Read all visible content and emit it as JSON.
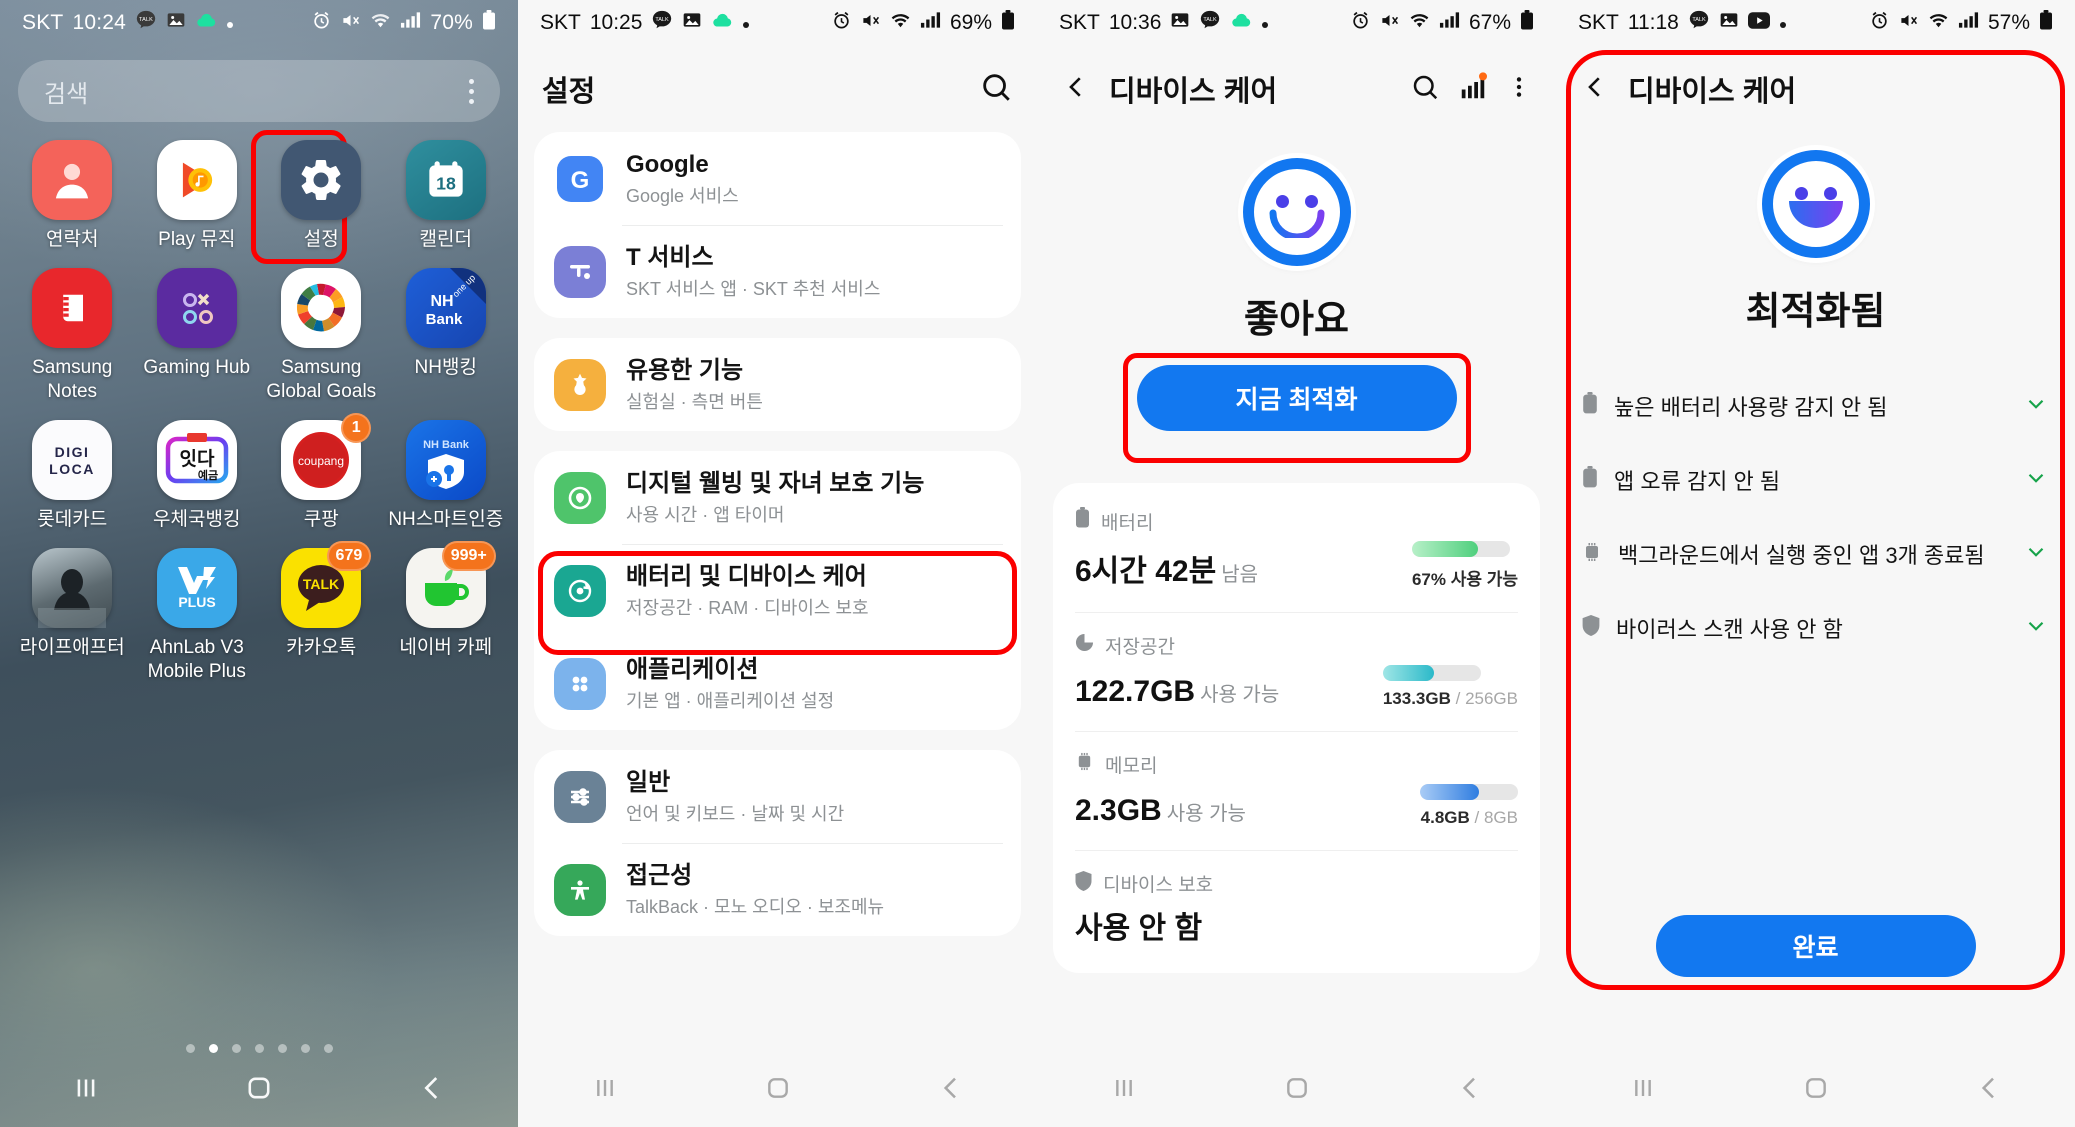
{
  "panel1": {
    "status": {
      "carrier": "SKT",
      "time": "10:24",
      "battery": "70%"
    },
    "search": {
      "placeholder": "검색"
    },
    "apps": [
      {
        "label": "연락처",
        "icon": "contacts-icon",
        "badge": null
      },
      {
        "label": "Play 뮤직",
        "icon": "play-music-icon",
        "badge": null
      },
      {
        "label": "설정",
        "icon": "settings-gear-icon",
        "badge": null,
        "highlighted": true
      },
      {
        "label": "캘린더",
        "icon": "calendar-icon",
        "badge": null,
        "day": "18"
      },
      {
        "label": "Samsung Notes",
        "icon": "samsung-notes-icon",
        "badge": null
      },
      {
        "label": "Gaming Hub",
        "icon": "gaming-hub-icon",
        "badge": null
      },
      {
        "label": "Samsung Global Goals",
        "icon": "global-goals-icon",
        "badge": null
      },
      {
        "label": "NH뱅킹",
        "icon": "nh-bank-icon",
        "badge": null,
        "mark": "one up"
      },
      {
        "label": "롯데카드",
        "icon": "digiloca-icon",
        "badge": null,
        "text1": "DIGI",
        "text2": "LOCA"
      },
      {
        "label": "우체국뱅킹",
        "icon": "itda-deposit-icon",
        "badge": null
      },
      {
        "label": "쿠팡",
        "icon": "coupang-icon",
        "badge": "1"
      },
      {
        "label": "NH스마트인증",
        "icon": "nh-smart-cert-icon",
        "badge": null
      },
      {
        "label": "라이프애프터",
        "icon": "lifeafter-icon",
        "badge": null
      },
      {
        "label": "AhnLab V3 Mobile Plus",
        "icon": "ahnlab-v3-icon",
        "badge": null
      },
      {
        "label": "카카오톡",
        "icon": "kakaotalk-icon",
        "badge": "679"
      },
      {
        "label": "네이버 카페",
        "icon": "naver-cafe-icon",
        "badge": "999+"
      }
    ],
    "page_dots": 7,
    "active_dot": 1
  },
  "panel2": {
    "status": {
      "carrier": "SKT",
      "time": "10:25",
      "battery": "69%"
    },
    "title": "설정",
    "search_icon": "search-icon",
    "groups": [
      {
        "items": [
          {
            "title": "Google",
            "sub": "Google 서비스",
            "icon": "google-icon",
            "color": "#4285f4"
          },
          {
            "title": "T 서비스",
            "sub": "SKT 서비스 앱 · SKT 추천 서비스",
            "icon": "t-service-icon",
            "color": "#7b7fd6"
          }
        ]
      },
      {
        "items": [
          {
            "title": "유용한 기능",
            "sub": "실험실 · 측면 버튼",
            "icon": "advanced-features-icon",
            "color": "#f5b03e"
          }
        ]
      },
      {
        "items": [
          {
            "title": "디지털 웰빙 및 자녀 보호 기능",
            "sub": "사용 시간 · 앱 타이머",
            "icon": "digital-wellbeing-icon",
            "color": "#4fc46b"
          },
          {
            "title": "배터리 및 디바이스 케어",
            "sub": "저장공간 · RAM · 디바이스 보호",
            "icon": "device-care-icon",
            "color": "#1aa792",
            "highlighted": true
          },
          {
            "title": "애플리케이션",
            "sub": "기본 앱 · 애플리케이션 설정",
            "icon": "applications-icon",
            "color": "#7cb3ec"
          }
        ]
      },
      {
        "items": [
          {
            "title": "일반",
            "sub": "언어 및 키보드 · 날짜 및 시간",
            "icon": "general-management-icon",
            "color": "#6a8296"
          },
          {
            "title": "접근성",
            "sub": "TalkBack · 모노 오디오 · 보조메뉴",
            "icon": "accessibility-icon",
            "color": "#36a85a"
          }
        ]
      }
    ]
  },
  "panel3": {
    "status": {
      "carrier": "SKT",
      "time": "10:36",
      "battery": "67%"
    },
    "title": "디바이스 케어",
    "actions": [
      "search-icon",
      "signal-bars-icon",
      "overflow-menu-icon"
    ],
    "face_icon": "smiley-face-icon",
    "status_text": "좋아요",
    "optimize_button": "지금 최적화",
    "metrics": [
      {
        "icon": "battery-icon",
        "label": "배터리",
        "value": "6시간 42분",
        "value_suffix": "남음",
        "caption": "67% 사용 가능",
        "caption_dim": "",
        "bar_percent": 67,
        "bar_color": "#5fd68a"
      },
      {
        "icon": "storage-icon",
        "label": "저장공간",
        "value": "122.7GB",
        "value_suffix": "사용 가능",
        "caption": "133.3GB",
        "caption_dim": "/ 256GB",
        "bar_percent": 52,
        "bar_color": "#3dc4ce"
      },
      {
        "icon": "memory-icon",
        "label": "메모리",
        "value": "2.3GB",
        "value_suffix": "사용 가능",
        "caption": "4.8GB",
        "caption_dim": "/ 8GB",
        "bar_percent": 60,
        "bar_color": "#3b82f6"
      },
      {
        "icon": "shield-icon",
        "label": "디바이스 보호",
        "value": "사용 안 함",
        "value_suffix": "",
        "caption": "",
        "caption_dim": "",
        "bar_percent": 0,
        "bar_color": ""
      }
    ]
  },
  "panel4": {
    "status": {
      "carrier": "SKT",
      "time": "11:18",
      "battery": "57%"
    },
    "title": "디바이스 케어",
    "face_icon": "smiley-face-open-icon",
    "status_text": "최적화됨",
    "results": [
      {
        "icon": "battery-icon",
        "text": "높은 배터리 사용량 감지 안 됨",
        "check": "chevron-down-icon"
      },
      {
        "icon": "battery-icon",
        "text": "앱 오류 감지 안 됨",
        "check": "chevron-down-icon"
      },
      {
        "icon": "memory-icon",
        "text": "백그라운드에서 실행 중인 앱 3개 종료됨",
        "check": "chevron-down-icon"
      },
      {
        "icon": "shield-icon",
        "text": "바이러스 스캔 사용 안 함",
        "check": "chevron-down-icon"
      }
    ],
    "done_button": "완료"
  },
  "colors": {
    "accent_blue": "#1278f0",
    "highlight_red": "#fb0000",
    "check_green": "#16a34a"
  }
}
